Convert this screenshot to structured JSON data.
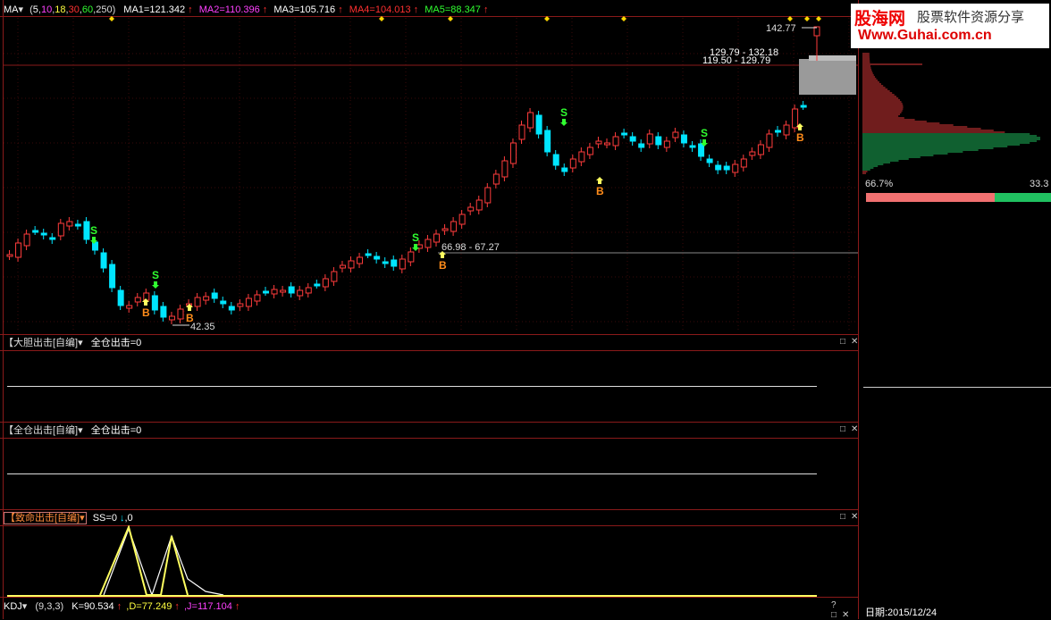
{
  "main": {
    "indicator": "MA",
    "params": [
      "5",
      "10",
      "18",
      "30",
      "60",
      "250"
    ],
    "ma": [
      {
        "label": "MA1=121.342",
        "color": "#ffffff"
      },
      {
        "label": "MA2=110.396",
        "color": "#ff40ff"
      },
      {
        "label": "MA3=105.716",
        "color": "#ffffff"
      },
      {
        "label": "MA4=104.013",
        "color": "#ff3030"
      },
      {
        "label": "MA5=88.347",
        "color": "#30ff30"
      }
    ],
    "annotations": {
      "high": "142.77",
      "low": "42.35",
      "range1": "129.79 - 132.18",
      "range2": "119.50 - 129.79",
      "range3": "66.98 - 67.27"
    },
    "signals": {
      "buy": "B",
      "sell": "S"
    }
  },
  "panels": [
    {
      "title": "【大胆出击[自编]",
      "formula": "全仓出击=0"
    },
    {
      "title": "【全仓出击[自编]",
      "formula": "全仓出击=0"
    },
    {
      "title": "【致命出击[自编]",
      "formula": "SS=0",
      "extra": ",0"
    }
  ],
  "kdj": {
    "name": "KDJ",
    "params": "(9,3,3)",
    "k": "K=90.534",
    "d": ",D=77.249",
    "j": ",J=117.104"
  },
  "controls": {
    "maximize": "□",
    "close": "✕",
    "help": "?"
  },
  "side": {
    "pct_left": "66.7%",
    "pct_right": "33.3",
    "date": "日期:2015/12/24"
  },
  "watermark": {
    "brand": "股海网",
    "slogan": "股票软件资源分享",
    "url": "Www.Guhai.com.cn"
  },
  "colors": {
    "up": "#ff3c3c",
    "down": "#00e5ff",
    "frame": "#8a1a1a"
  }
}
